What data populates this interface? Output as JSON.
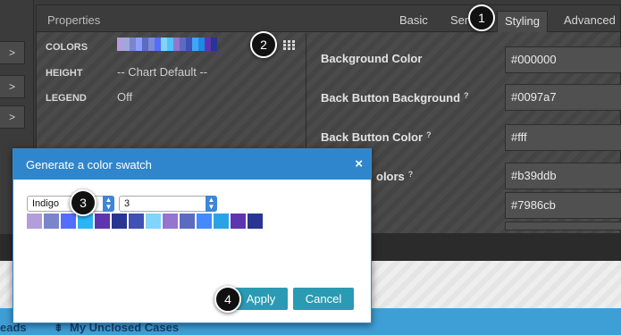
{
  "left_strip": {
    "arrow_glyph": ">"
  },
  "panel": {
    "title": "Properties",
    "tabs": [
      {
        "label": "Basic"
      },
      {
        "label": "Ser"
      },
      {
        "label": "Styling"
      },
      {
        "label": "Advanced"
      }
    ]
  },
  "settings": {
    "colors_label": "COLORS",
    "height_label": "HEIGHT",
    "height_value": "-- Chart Default --",
    "legend_label": "LEGEND",
    "legend_value": "Off",
    "swatch_colors": [
      "#b39ddb",
      "#9fa8da",
      "#7986cb",
      "#8c9eff",
      "#5c6bc0",
      "#7e8ad6",
      "#536dfe",
      "#81d4fa",
      "#4fc3f7",
      "#9575cd",
      "#5c6bc0",
      "#3f51b5",
      "#42a5f5",
      "#1e88e5",
      "#5e35b1",
      "#283593"
    ],
    "grid_icon": "grid-icon"
  },
  "styling": {
    "rows": [
      {
        "label": "Background Color",
        "help": false,
        "value": "#000000"
      },
      {
        "label": "Back Button Background",
        "help": true,
        "value": "#0097a7"
      },
      {
        "label": "Back Button Color",
        "help": true,
        "value": "#fff"
      },
      {
        "label": "olors",
        "help": true,
        "value": "#b39ddb"
      },
      {
        "label": "",
        "help": false,
        "value": "#7986cb"
      }
    ],
    "help_glyph": "?"
  },
  "bottom": {
    "blue_left": "eads",
    "blue_right": "My Unclosed Cases"
  },
  "dialog": {
    "title": "Generate a color swatch",
    "close_glyph": "×",
    "palette_value": "Indigo",
    "count_value": "3",
    "swatches": [
      "#b39ddb",
      "#7986cb",
      "#536dfe",
      "#29b6f6",
      "#5e35b1",
      "#283593",
      "#3f51b5",
      "#81d4fa",
      "#9575cd",
      "#5c6bc0",
      "#448aff",
      "#29a3e6",
      "#5e35b1",
      "#283593"
    ],
    "apply_label": "Apply",
    "cancel_label": "Cancel",
    "apply_color": "#2a9bb3",
    "cancel_color": "#2a9bb3"
  },
  "callouts": [
    "1",
    "2",
    "3",
    "4"
  ]
}
